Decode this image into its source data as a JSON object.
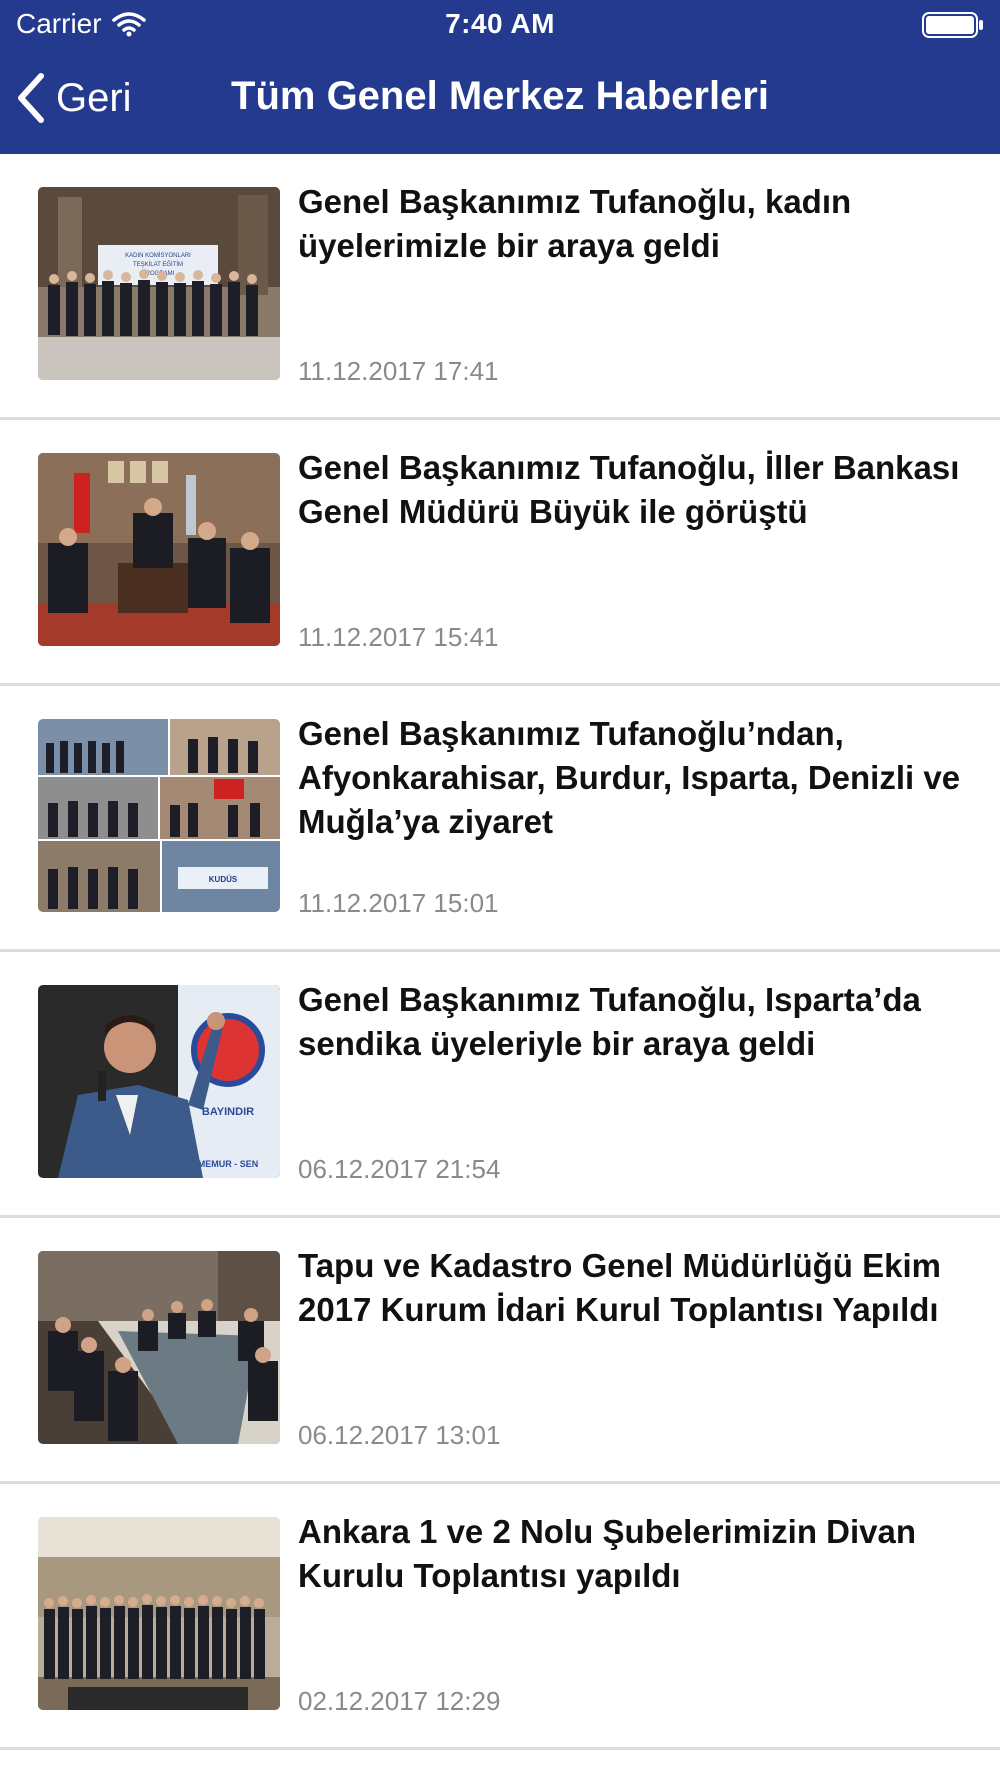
{
  "status_bar": {
    "carrier": "Carrier",
    "time": "7:40 AM"
  },
  "navbar": {
    "back_label": "Geri",
    "title": "Tüm Genel Merkez Haberleri"
  },
  "colors": {
    "header_bg": "#233a8f",
    "title_text": "#111111",
    "date_text": "#8a8a8a",
    "divider": "#dcdcdc"
  },
  "news": [
    {
      "title": "Genel Başkanımız Tufanoğlu, kadın üyelerimizle bir araya geldi",
      "date": "11.12.2017 17:41",
      "image_banner": [
        "KADIN KOMİSYONLARI",
        "TEŞKİLAT EĞİTİM",
        "PROGRAMI"
      ]
    },
    {
      "title": "Genel Başkanımız Tufanoğlu, İller Bankası Genel Müdürü Büyük ile görüştü",
      "date": "11.12.2017 15:41"
    },
    {
      "title": "Genel Başkanımız Tufanoğlu’ndan, Afyonkarahisar, Burdur, Isparta, Denizli ve Muğla’ya ziyaret",
      "date": "11.12.2017 15:01",
      "image_banner": [
        "KUDÜS"
      ]
    },
    {
      "title": "Genel Başkanımız Tufanoğlu, Isparta’da sendika üyeleriyle bir araya geldi",
      "date": "06.12.2017 21:54",
      "image_banner": [
        "BAYINDIR",
        "MEMUR - SEN"
      ]
    },
    {
      "title": "Tapu ve Kadastro Genel Müdürlüğü Ekim 2017 Kurum İdari Kurul Toplantısı Yapıldı",
      "date": "06.12.2017 13:01"
    },
    {
      "title": "Ankara 1 ve 2 Nolu Şubelerimizin Divan Kurulu Toplantısı yapıldı",
      "date": "02.12.2017 12:29"
    }
  ]
}
